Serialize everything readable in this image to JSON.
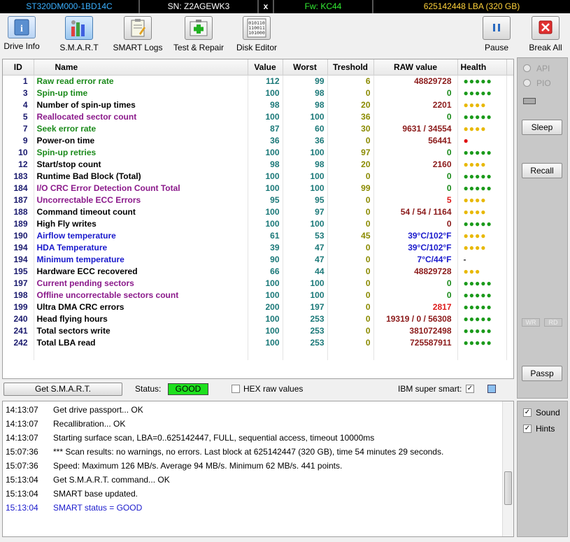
{
  "infobar": {
    "model": "ST320DM000-1BD14C",
    "serial": "SN: Z2AGEWK3",
    "close": "x",
    "firmware": "Fw: KC44",
    "lba": "625142448 LBA (320 GB)"
  },
  "toolbar": {
    "drive_info": "Drive Info",
    "smart": "S.M.A.R.T",
    "smart_logs": "SMART Logs",
    "test_repair": "Test & Repair",
    "disk_editor": "Disk Editor",
    "pause": "Pause",
    "break_all": "Break All"
  },
  "colors": {
    "green": "#1a8a1a",
    "purple": "#8b1a8b",
    "blue": "#1a1acc",
    "good": "#1ee01e"
  },
  "table": {
    "headers": [
      "ID",
      "Name",
      "Value",
      "Worst",
      "Treshold",
      "RAW value",
      "Health"
    ],
    "rows": [
      {
        "id": "1",
        "name": "Raw read error rate",
        "value": "112",
        "worst": "99",
        "thr": "6",
        "raw": "48829728",
        "health": "●●●●●",
        "nc": "green",
        "rc": "",
        "hc": "g"
      },
      {
        "id": "3",
        "name": "Spin-up time",
        "value": "100",
        "worst": "98",
        "thr": "0",
        "raw": "0",
        "health": "●●●●●",
        "nc": "green",
        "rc": "green",
        "hc": "g"
      },
      {
        "id": "4",
        "name": "Number of spin-up times",
        "value": "98",
        "worst": "98",
        "thr": "20",
        "raw": "2201",
        "health": "●●●●",
        "nc": "black",
        "rc": "",
        "hc": "y"
      },
      {
        "id": "5",
        "name": "Reallocated sector count",
        "value": "100",
        "worst": "100",
        "thr": "36",
        "raw": "0",
        "health": "●●●●●",
        "nc": "purple",
        "rc": "green",
        "hc": "g"
      },
      {
        "id": "7",
        "name": "Seek error rate",
        "value": "87",
        "worst": "60",
        "thr": "30",
        "raw": "9631 / 34554",
        "health": "●●●●",
        "nc": "green",
        "rc": "",
        "hc": "y"
      },
      {
        "id": "9",
        "name": "Power-on time",
        "value": "36",
        "worst": "36",
        "thr": "0",
        "raw": "56441",
        "health": "●",
        "nc": "black",
        "rc": "",
        "hc": "r"
      },
      {
        "id": "10",
        "name": "Spin-up retries",
        "value": "100",
        "worst": "100",
        "thr": "97",
        "raw": "0",
        "health": "●●●●●",
        "nc": "green",
        "rc": "green",
        "hc": "g"
      },
      {
        "id": "12",
        "name": "Start/stop count",
        "value": "98",
        "worst": "98",
        "thr": "20",
        "raw": "2160",
        "health": "●●●●",
        "nc": "black",
        "rc": "",
        "hc": "y"
      },
      {
        "id": "183",
        "name": "Runtime Bad Block (Total)",
        "value": "100",
        "worst": "100",
        "thr": "0",
        "raw": "0",
        "health": "●●●●●",
        "nc": "black",
        "rc": "green",
        "hc": "g"
      },
      {
        "id": "184",
        "name": "I/O CRC Error Detection Count Total",
        "value": "100",
        "worst": "100",
        "thr": "99",
        "raw": "0",
        "health": "●●●●●",
        "nc": "purple",
        "rc": "green",
        "hc": "g"
      },
      {
        "id": "187",
        "name": "Uncorrectable ECC Errors",
        "value": "95",
        "worst": "95",
        "thr": "0",
        "raw": "5",
        "health": "●●●●",
        "nc": "purple",
        "rc": "red",
        "hc": "y"
      },
      {
        "id": "188",
        "name": "Command timeout count",
        "value": "100",
        "worst": "97",
        "thr": "0",
        "raw": "54 / 54 / 1164",
        "health": "●●●●",
        "nc": "black",
        "rc": "",
        "hc": "y"
      },
      {
        "id": "189",
        "name": "High Fly writes",
        "value": "100",
        "worst": "100",
        "thr": "0",
        "raw": "0",
        "health": "●●●●●",
        "nc": "black",
        "rc": "",
        "hc": "g"
      },
      {
        "id": "190",
        "name": "Airflow temperature",
        "value": "61",
        "worst": "53",
        "thr": "45",
        "raw": "39°C/102°F",
        "health": "●●●●",
        "nc": "blue",
        "rc": "blue",
        "hc": "y"
      },
      {
        "id": "194",
        "name": "HDA Temperature",
        "value": "39",
        "worst": "47",
        "thr": "0",
        "raw": "39°C/102°F",
        "health": "●●●●",
        "nc": "blue",
        "rc": "blue",
        "hc": "y"
      },
      {
        "id": "194",
        "name": "Minimum temperature",
        "value": "90",
        "worst": "47",
        "thr": "0",
        "raw": "7°C/44°F",
        "health": "-",
        "nc": "blue",
        "rc": "blue",
        "hc": "n"
      },
      {
        "id": "195",
        "name": "Hardware ECC recovered",
        "value": "66",
        "worst": "44",
        "thr": "0",
        "raw": "48829728",
        "health": "●●●",
        "nc": "black",
        "rc": "",
        "hc": "y"
      },
      {
        "id": "197",
        "name": "Current pending sectors",
        "value": "100",
        "worst": "100",
        "thr": "0",
        "raw": "0",
        "health": "●●●●●",
        "nc": "purple",
        "rc": "green",
        "hc": "g"
      },
      {
        "id": "198",
        "name": "Offline uncorrectable sectors count",
        "value": "100",
        "worst": "100",
        "thr": "0",
        "raw": "0",
        "health": "●●●●●",
        "nc": "purple",
        "rc": "green",
        "hc": "g"
      },
      {
        "id": "199",
        "name": "Ultra DMA CRC errors",
        "value": "200",
        "worst": "197",
        "thr": "0",
        "raw": "2817",
        "health": "●●●●●",
        "nc": "black",
        "rc": "red",
        "hc": "g"
      },
      {
        "id": "240",
        "name": "Head flying hours",
        "value": "100",
        "worst": "253",
        "thr": "0",
        "raw": "19319 / 0 / 56308",
        "health": "●●●●●",
        "nc": "black",
        "rc": "",
        "hc": "g"
      },
      {
        "id": "241",
        "name": "Total sectors write",
        "value": "100",
        "worst": "253",
        "thr": "0",
        "raw": "381072498",
        "health": "●●●●●",
        "nc": "black",
        "rc": "",
        "hc": "g"
      },
      {
        "id": "242",
        "name": "Total LBA read",
        "value": "100",
        "worst": "253",
        "thr": "0",
        "raw": "725587911",
        "health": "●●●●●",
        "nc": "black",
        "rc": "",
        "hc": "g"
      }
    ]
  },
  "status": {
    "get_smart": "Get S.M.A.R.T.",
    "label": "Status:",
    "value": "GOOD",
    "hex_label": "HEX raw values",
    "ibm_label": "IBM super smart:",
    "ibm_check": "✓"
  },
  "log": [
    {
      "time": "14:13:07",
      "msg": "Get drive passport... OK",
      "blue": false
    },
    {
      "time": "14:13:07",
      "msg": "Recallibration... OK",
      "blue": false
    },
    {
      "time": "14:13:07",
      "msg": "Starting surface scan, LBA=0..625142447, FULL, sequential access, timeout 10000ms",
      "blue": false
    },
    {
      "time": "15:07:36",
      "msg": "*** Scan results: no warnings, no errors. Last block at 625142447 (320 GB), time 54 minutes 29 seconds.",
      "blue": false
    },
    {
      "time": "15:07:36",
      "msg": "Speed: Maximum 126 MB/s. Average 94 MB/s. Minimum 62 MB/s. 441 points.",
      "blue": false
    },
    {
      "time": "15:13:04",
      "msg": "Get S.M.A.R.T. command... OK",
      "blue": false
    },
    {
      "time": "15:13:04",
      "msg": "SMART base updated.",
      "blue": false
    },
    {
      "time": "15:13:04",
      "msg": "SMART status = GOOD",
      "blue": true
    }
  ],
  "right": {
    "api": "API",
    "pio": "PIO",
    "sleep": "Sleep",
    "recall": "Recall",
    "wr": "WR",
    "rd": "RD",
    "passp": "Passp",
    "sound": "Sound",
    "hints": "Hints",
    "check": "✓"
  }
}
